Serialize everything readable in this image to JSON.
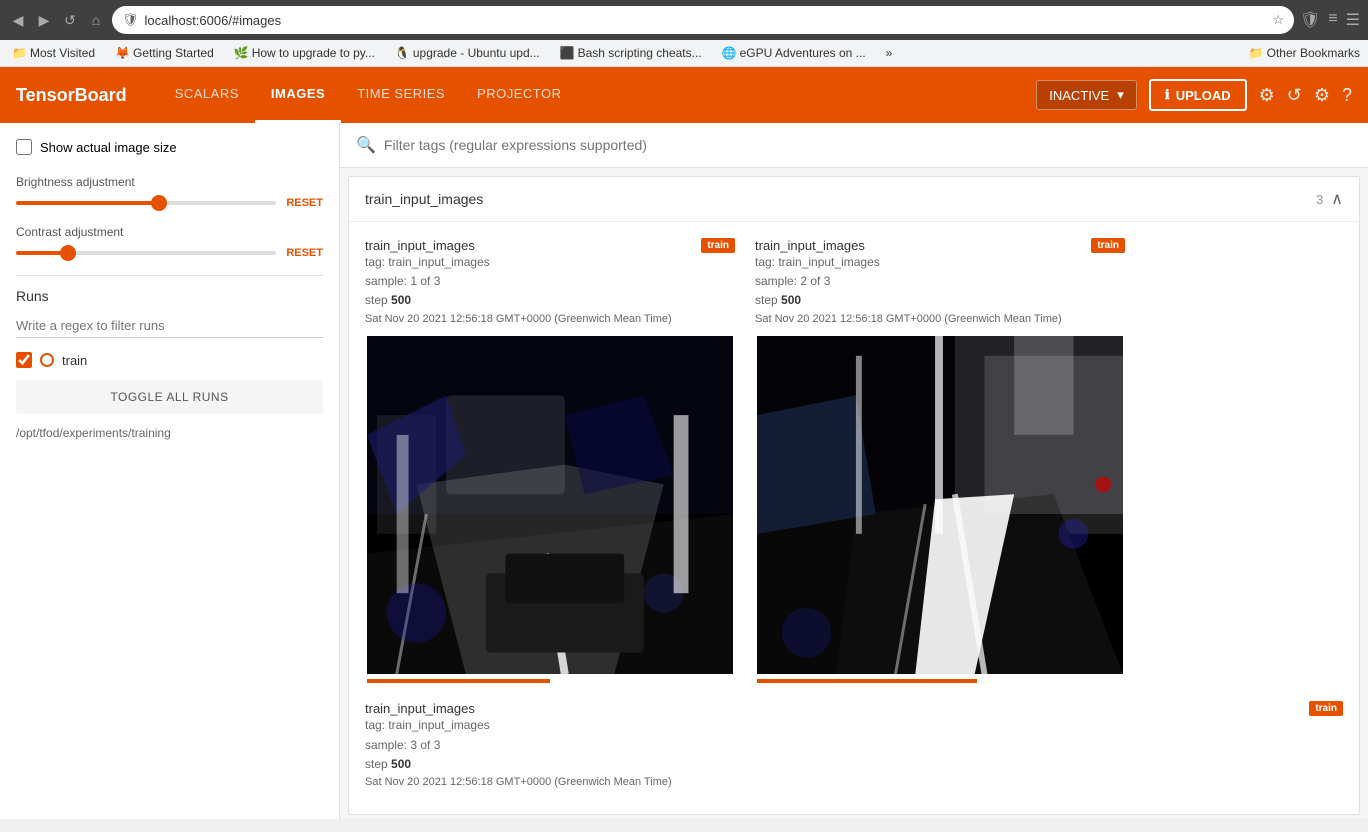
{
  "browser": {
    "back_btn": "◀",
    "forward_btn": "▶",
    "reload_btn": "↺",
    "home_btn": "⌂",
    "url": "localhost:6006/#images",
    "star_icon": "☆",
    "shield_icon": "🛡",
    "bars_icon": "≡",
    "menu_icon": "☰"
  },
  "bookmarks": {
    "most_visited": "Most Visited",
    "getting_started": "Getting Started",
    "upgrade_py": "How to upgrade to py...",
    "upgrade_ubuntu": "upgrade - Ubuntu upd...",
    "bash_scripting": "Bash scripting cheats...",
    "egpu": "eGPU Adventures on ...",
    "more": "»",
    "other_bookmarks": "Other Bookmarks"
  },
  "header": {
    "logo": "TensorBoard",
    "nav": {
      "scalars": "SCALARS",
      "images": "IMAGES",
      "time_series": "TIME SERIES",
      "projector": "PROJECTOR"
    },
    "inactive_label": "INACTIVE",
    "upload_label": "UPLOAD",
    "upload_icon": "ℹ"
  },
  "sidebar": {
    "show_size_label": "Show actual image size",
    "brightness_label": "Brightness adjustment",
    "brightness_reset": "RESET",
    "contrast_label": "Contrast adjustment",
    "contrast_reset": "RESET",
    "runs_label": "Runs",
    "runs_placeholder": "Write a regex to filter runs",
    "run_name": "train",
    "toggle_all_btn": "TOGGLE ALL RUNS",
    "experiment_path": "/opt/tfod/experiments/training"
  },
  "content": {
    "filter_placeholder": "Filter tags (regular expressions supported)",
    "section_title": "train_input_images",
    "section_count": "3",
    "card1": {
      "title": "train_input_images",
      "badge": "train",
      "tag": "tag: train_input_images",
      "sample": "sample: 1 of 3",
      "step_label": "step",
      "step_value": "500",
      "timestamp": "Sat Nov 20 2021 12:56:18 GMT+0000 (Greenwich Mean Time)"
    },
    "card2": {
      "title": "train_input_images",
      "badge": "train",
      "tag": "tag: train_input_images",
      "sample": "sample: 2 of 3",
      "step_label": "step",
      "step_value": "500",
      "timestamp": "Sat Nov 20 2021 12:56:18 GMT+0000 (Greenwich Mean Time)"
    },
    "card3": {
      "title": "train_input_images",
      "badge": "train",
      "tag": "tag: train_input_images",
      "sample": "sample: 3 of 3",
      "step_label": "step",
      "step_value": "500",
      "timestamp": "Sat Nov 20 2021 12:56:18 GMT+0000 (Greenwich Mean Time)"
    }
  },
  "colors": {
    "primary": "#e65100",
    "header_bg": "#e65100",
    "nav_active_border": "#ffffff"
  }
}
